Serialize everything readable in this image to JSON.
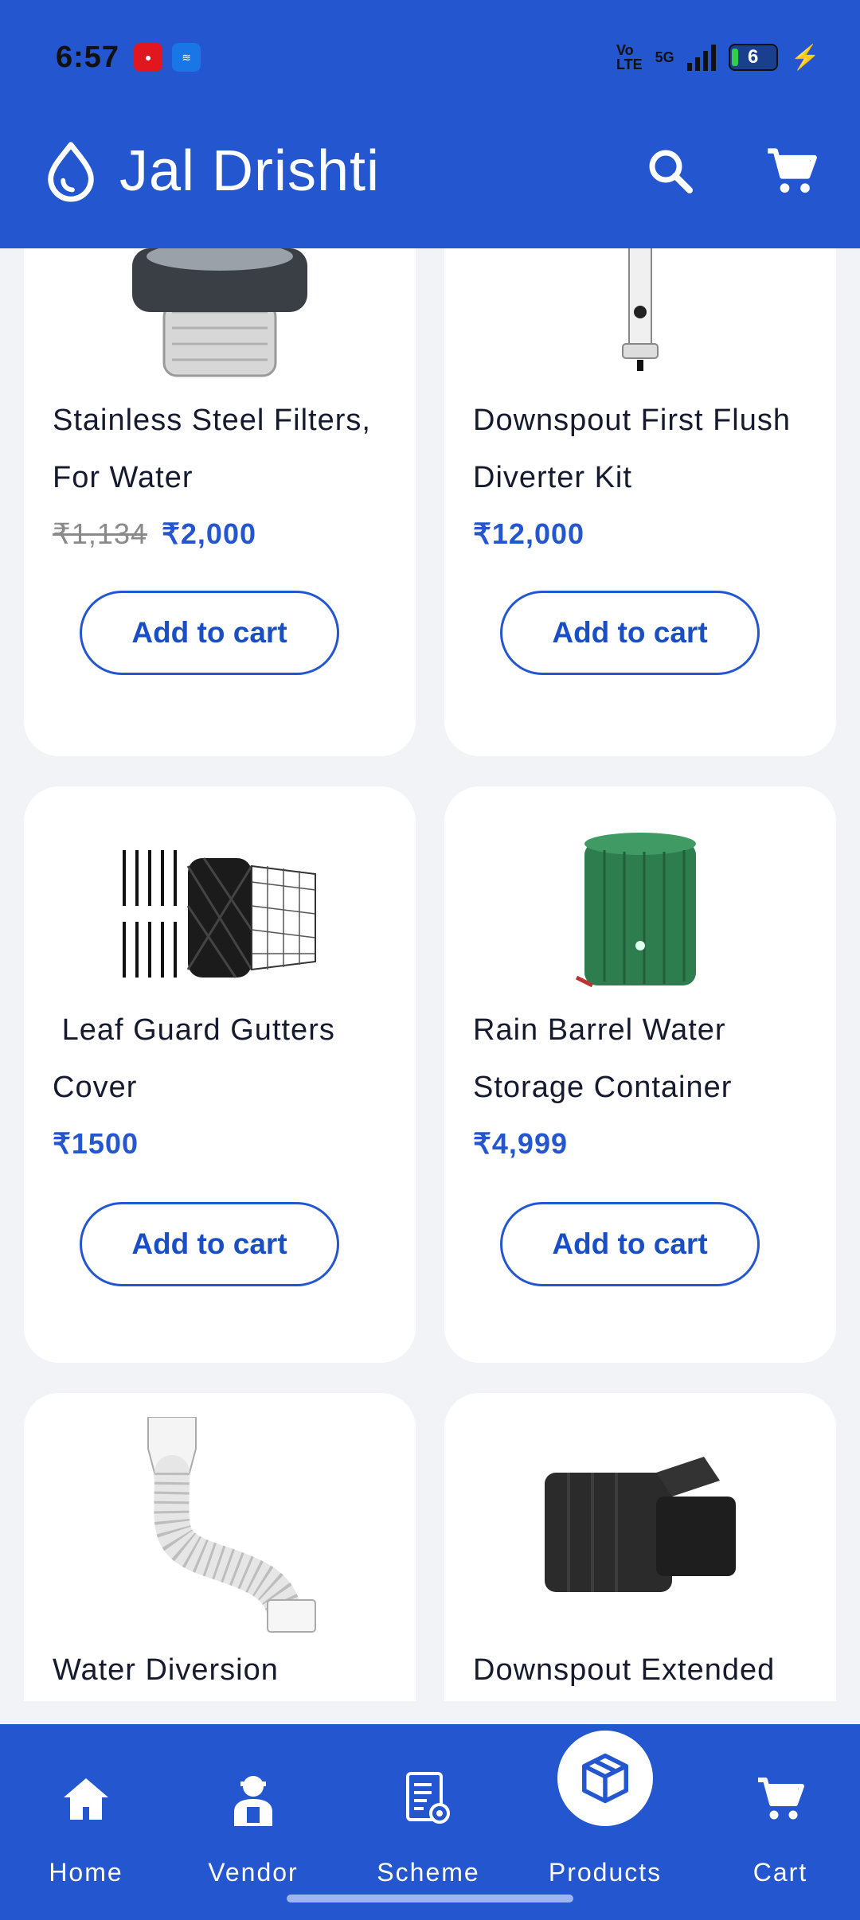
{
  "status_bar": {
    "time": "6:57",
    "network": "Vo\nLTE",
    "signal_label": "5G",
    "battery": "6"
  },
  "header": {
    "app_title": "Jal Drishti",
    "logo_icon": "water-drop-icon",
    "search_icon": "search-icon",
    "cart_icon": "cart-icon"
  },
  "products": [
    {
      "name": "Stainless Steel Filters, For Water",
      "old_price": "₹1,134",
      "price": "₹2,000",
      "button": "Add to cart",
      "image": "basket-strainer"
    },
    {
      "name": "Downspout First Flush Diverter Kit",
      "old_price": "",
      "price": "₹12,000",
      "button": "Add to cart",
      "image": "first-flush-diverter"
    },
    {
      "name": " Leaf Guard Gutters Cover",
      "old_price": "",
      "price": "₹1500",
      "button": "Add to cart",
      "image": "leaf-guard-mesh"
    },
    {
      "name": "Rain Barrel Water Storage Container",
      "old_price": "",
      "price": "₹4,999",
      "button": "Add to cart",
      "image": "green-rain-barrel"
    },
    {
      "name": "Water Diversion",
      "old_price": "",
      "price": "",
      "button": "",
      "image": "flexible-downspout"
    },
    {
      "name": "Downspout Extended",
      "old_price": "",
      "price": "",
      "button": "",
      "image": "black-downspout-adapter"
    }
  ],
  "bottom_nav": {
    "items": [
      {
        "label": "Home",
        "icon": "home-icon"
      },
      {
        "label": "Vendor",
        "icon": "vendor-icon"
      },
      {
        "label": "Scheme",
        "icon": "scheme-document-icon"
      },
      {
        "label": "Products",
        "icon": "box-icon",
        "active": true
      },
      {
        "label": "Cart",
        "icon": "cart-icon"
      }
    ]
  },
  "colors": {
    "primary": "#2356cf",
    "background": "#f2f3f7",
    "card": "#ffffff",
    "price": "#2356cf"
  }
}
